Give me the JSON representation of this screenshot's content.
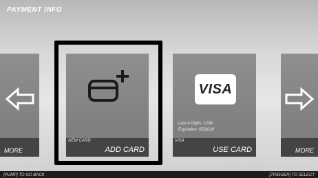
{
  "header": {
    "title": "PAYMENT INFO"
  },
  "cards": {
    "more_left": {
      "label": "MORE"
    },
    "add_card": {
      "small_label": "NEW CARD",
      "label": "ADD CARD"
    },
    "use_card": {
      "brand": "VISA",
      "last4": "Last 4 Digits: 1234",
      "expiration": "Expiration: 05/2018",
      "small_label": "VISA",
      "label": "USE CARD"
    },
    "more_right": {
      "label": "MORE"
    }
  },
  "footer": {
    "left_hint": "[PUMP] TO GO BACK",
    "right_hint": "[TRIGGER] TO SELECT"
  },
  "icons": {
    "add_card": "credit-card-plus-icon",
    "left": "arrow-left-icon",
    "right": "arrow-right-icon"
  }
}
